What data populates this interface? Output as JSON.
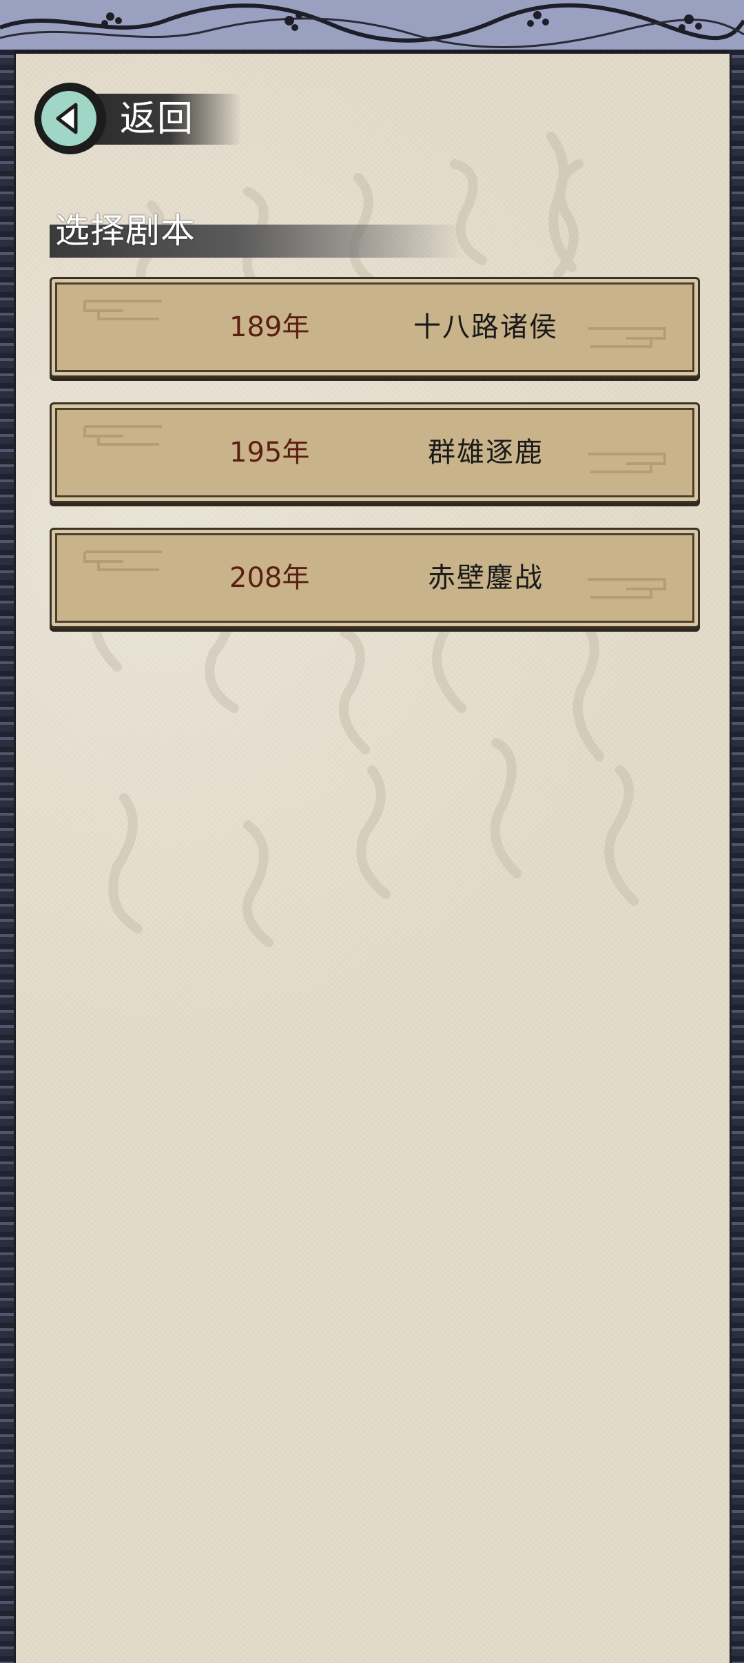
{
  "header": {
    "back_label": "返回",
    "section_title": "选择剧本"
  },
  "scenarios": [
    {
      "year": "189年",
      "name": "十八路诸侯"
    },
    {
      "year": "195年",
      "name": "群雄逐鹿"
    },
    {
      "year": "208年",
      "name": "赤壁鏖战"
    }
  ],
  "colors": {
    "paper": "#e4dccb",
    "button_fill": "#c9b38a",
    "year_text": "#5a1e12",
    "back_circle": "#9fd6c6",
    "top_band": "#9aa0c0"
  },
  "icons": {
    "back": "back-arrow-icon",
    "scroll_ornament": "cloud-scroll-icon"
  }
}
